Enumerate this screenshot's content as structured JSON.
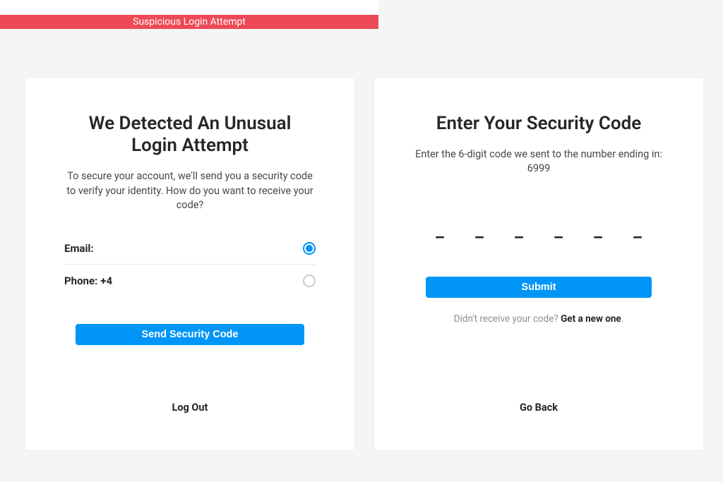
{
  "alert": {
    "text": "Suspicious Login Attempt"
  },
  "left": {
    "title": "We Detected An Unusual Login Attempt",
    "desc": "To secure your account, we'll send you a security code to verify your identity. How do you want to receive your code?",
    "emailLabel": "Email:",
    "emailValue": "",
    "phoneLabel": "Phone:",
    "phoneValue": "+4",
    "sendBtn": "Send Security Code",
    "logout": "Log Out"
  },
  "right": {
    "title": "Enter Your Security Code",
    "descPrefix": "Enter the 6-digit code we sent to the number ending in: ",
    "descCode": "6999",
    "digits": [
      "_",
      "_",
      "_",
      "_",
      "_",
      "_"
    ],
    "submit": "Submit",
    "resendPrompt": "Didn't receive your code? ",
    "resendLink": "Get a new one",
    "resendPeriod": ".",
    "goBack": "Go Back"
  }
}
